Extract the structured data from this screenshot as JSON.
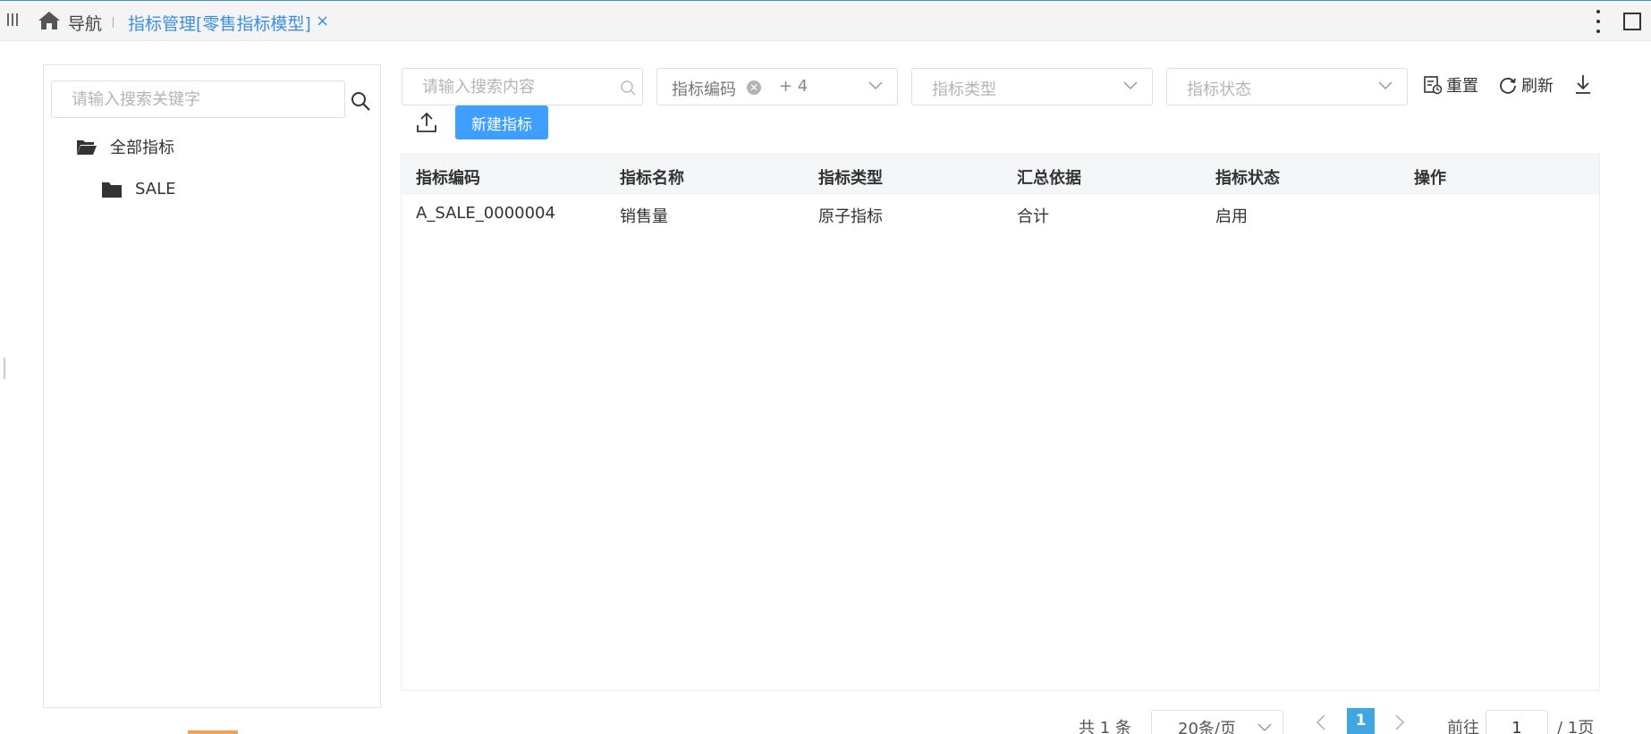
{
  "topbar": {
    "nav_label": "导航",
    "active_tab": "指标管理[零售指标模型]",
    "close_glyph": "×"
  },
  "left": {
    "search_placeholder": "请输入搜索关键字",
    "tree": [
      {
        "label": "全部指标"
      },
      {
        "label": "SALE"
      }
    ]
  },
  "filters": {
    "search_placeholder": "请输入搜索内容",
    "code_tag": "指标编码",
    "code_more": "+ 4",
    "type_placeholder": "指标类型",
    "status_placeholder": "指标状态"
  },
  "toolbar": {
    "reset": "重置",
    "refresh": "刷新",
    "new_button": "新建指标"
  },
  "table": {
    "headers": [
      "指标编码",
      "指标名称",
      "指标类型",
      "汇总依据",
      "指标状态",
      "操作"
    ],
    "rows": [
      [
        "A_SALE_0000004",
        "销售量",
        "原子指标",
        "合计",
        "启用",
        ""
      ]
    ]
  },
  "pagination": {
    "total": "共 1 条",
    "page_size": "20条/页",
    "current": "1",
    "goto_label": "前往",
    "goto_value": "1",
    "pages": "/ 1页"
  },
  "colors": {
    "accent": "#409eff",
    "tab_active": "#3a8ee6",
    "pager_current": "#3fa6e0"
  }
}
